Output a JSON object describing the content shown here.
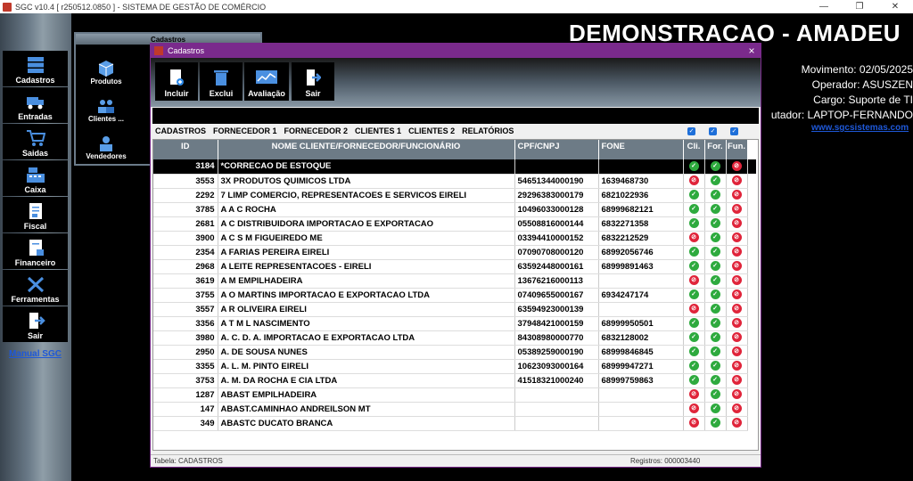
{
  "window": {
    "title": "SGC v10.4 [ r250512.0850 ] - SISTEMA DE GESTÃO DE COMÉRCIO"
  },
  "header": {
    "company": "DEMONSTRACAO - AMADEU",
    "movimento": "Movimento: 02/05/2025",
    "operador": "Operador: ASUSZEN",
    "cargo": "Cargo: Suporte de TI",
    "computador": "utador: LAPTOP-FERNANDO",
    "site": "www.sgcsistemas.com"
  },
  "sidebar": {
    "items": [
      {
        "label": "Cadastros",
        "icon": "cadastros-icon"
      },
      {
        "label": "Entradas",
        "icon": "truck-icon"
      },
      {
        "label": "Saidas",
        "icon": "cart-icon"
      },
      {
        "label": "Caixa",
        "icon": "cash-register-icon"
      },
      {
        "label": "Fiscal",
        "icon": "document-icon"
      },
      {
        "label": "Financeiro",
        "icon": "finance-document-icon"
      },
      {
        "label": "Ferramentas",
        "icon": "tools-icon"
      },
      {
        "label": "Sair",
        "icon": "exit-icon"
      }
    ],
    "manual": "Manual SGC"
  },
  "bg_panel": {
    "title": "Cadastros",
    "buttons": [
      {
        "label": "Produtos"
      },
      {
        "label": "Clientes ..."
      },
      {
        "label": "Vendedores"
      }
    ]
  },
  "dialog": {
    "title": "Cadastros",
    "close": "×",
    "toolbar": [
      {
        "label": "Incluir"
      },
      {
        "label": "Exclui"
      },
      {
        "label": "Avaliação"
      },
      {
        "label": "Sair"
      }
    ],
    "tabs": [
      "CADASTROS",
      "FORNECEDOR 1",
      "FORNECEDOR 2",
      "CLIENTES 1",
      "CLIENTES 2",
      "RELATÓRIOS"
    ],
    "columns": {
      "id": "ID",
      "nome": "NOME CLIENTE/FORNECEDOR/FUNCIONÁRIO",
      "cpf": "CPF/CNPJ",
      "fone": "FONE",
      "cli": "Cli.",
      "for": "For.",
      "fun": "Fun."
    },
    "rows": [
      {
        "id": "3184",
        "nome": "*CORRECAO DE ESTOQUE",
        "cpf": "",
        "fone": "",
        "cli": true,
        "for": true,
        "fun": false
      },
      {
        "id": "3553",
        "nome": "3X PRODUTOS QUIMICOS LTDA",
        "cpf": "54651344000190",
        "fone": "1639468730",
        "cli": false,
        "for": true,
        "fun": false
      },
      {
        "id": "2292",
        "nome": "7 LIMP COMERCIO, REPRESENTACOES E SERVICOS EIRELI",
        "cpf": "29296383000179",
        "fone": "6821022936",
        "cli": true,
        "for": true,
        "fun": false
      },
      {
        "id": "3785",
        "nome": "A A C ROCHA",
        "cpf": "10496033000128",
        "fone": "68999682121",
        "cli": true,
        "for": true,
        "fun": false
      },
      {
        "id": "2681",
        "nome": "A C DISTRIBUIDORA IMPORTACAO E EXPORTACAO",
        "cpf": "05508816000144",
        "fone": "6832271358",
        "cli": true,
        "for": true,
        "fun": false
      },
      {
        "id": "3900",
        "nome": "A C S M FIGUEIREDO ME",
        "cpf": "03394410000152",
        "fone": "6832212529",
        "cli": false,
        "for": true,
        "fun": false
      },
      {
        "id": "2354",
        "nome": "A FARIAS PEREIRA EIRELI",
        "cpf": "07090708000120",
        "fone": "68992056746",
        "cli": true,
        "for": true,
        "fun": false
      },
      {
        "id": "2968",
        "nome": "A LEITE REPRESENTACOES - EIRELI",
        "cpf": "63592448000161",
        "fone": "68999891463",
        "cli": true,
        "for": true,
        "fun": false
      },
      {
        "id": "3619",
        "nome": "A M EMPILHADEIRA",
        "cpf": "13676216000113",
        "fone": "",
        "cli": false,
        "for": true,
        "fun": false
      },
      {
        "id": "3755",
        "nome": "A O MARTINS IMPORTACAO E EXPORTACAO LTDA",
        "cpf": "07409655000167",
        "fone": "6934247174",
        "cli": true,
        "for": true,
        "fun": false
      },
      {
        "id": "3557",
        "nome": "A R OLIVEIRA EIRELI",
        "cpf": "63594923000139",
        "fone": "",
        "cli": false,
        "for": true,
        "fun": false
      },
      {
        "id": "3356",
        "nome": "A T M L NASCIMENTO",
        "cpf": "37948421000159",
        "fone": "68999950501",
        "cli": true,
        "for": true,
        "fun": false
      },
      {
        "id": "3980",
        "nome": "A. C. D. A. IMPORTACAO E EXPORTACAO LTDA",
        "cpf": "84308980000770",
        "fone": "6832128002",
        "cli": true,
        "for": true,
        "fun": false
      },
      {
        "id": "2950",
        "nome": "A. DE SOUSA NUNES",
        "cpf": "05389259000190",
        "fone": "68999846845",
        "cli": true,
        "for": true,
        "fun": false
      },
      {
        "id": "3355",
        "nome": "A. L. M. PINTO EIRELI",
        "cpf": "10623093000164",
        "fone": "68999947271",
        "cli": true,
        "for": true,
        "fun": false
      },
      {
        "id": "3753",
        "nome": "A. M. DA ROCHA E CIA LTDA",
        "cpf": "41518321000240",
        "fone": "68999759863",
        "cli": true,
        "for": true,
        "fun": false
      },
      {
        "id": "1287",
        "nome": "ABAST EMPILHADEIRA",
        "cpf": "",
        "fone": "",
        "cli": false,
        "for": true,
        "fun": false
      },
      {
        "id": "147",
        "nome": "ABAST.CAMINHAO ANDREILSON MT",
        "cpf": "",
        "fone": "",
        "cli": false,
        "for": true,
        "fun": false
      },
      {
        "id": "349",
        "nome": "ABASTC DUCATO BRANCA",
        "cpf": "",
        "fone": "",
        "cli": false,
        "for": true,
        "fun": false
      }
    ],
    "status_left": "Tabela: CADASTROS",
    "status_right": "Registros: 000003440"
  }
}
